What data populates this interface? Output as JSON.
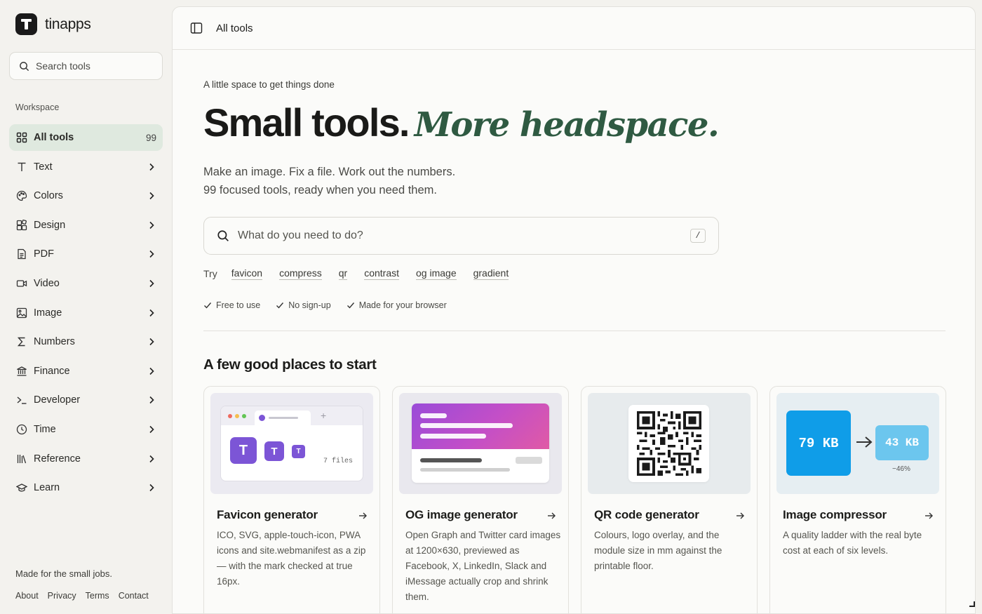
{
  "app": {
    "name": "tinapps"
  },
  "sidebar": {
    "search_placeholder": "Search tools",
    "section_label": "Workspace",
    "items": [
      {
        "label": "All tools",
        "count": "99",
        "icon": "grid-icon",
        "active": true
      },
      {
        "label": "Text",
        "icon": "text-icon"
      },
      {
        "label": "Colors",
        "icon": "palette-icon"
      },
      {
        "label": "Design",
        "icon": "design-icon"
      },
      {
        "label": "PDF",
        "icon": "document-icon"
      },
      {
        "label": "Video",
        "icon": "video-icon"
      },
      {
        "label": "Image",
        "icon": "image-icon"
      },
      {
        "label": "Numbers",
        "icon": "sigma-icon"
      },
      {
        "label": "Finance",
        "icon": "bank-icon"
      },
      {
        "label": "Developer",
        "icon": "terminal-icon"
      },
      {
        "label": "Time",
        "icon": "clock-icon"
      },
      {
        "label": "Reference",
        "icon": "library-icon"
      },
      {
        "label": "Learn",
        "icon": "graduation-cap-icon"
      }
    ],
    "footer_text": "Made for the small jobs.",
    "footer_links": [
      "About",
      "Privacy",
      "Terms",
      "Contact"
    ]
  },
  "topbar": {
    "title": "All tools"
  },
  "hero": {
    "eyebrow": "A little space to get things done",
    "title_plain": "Small tools.",
    "title_italic": "More headspace.",
    "lede_line1": "Make an image. Fix a file. Work out the numbers.",
    "lede_line2": "99 focused tools, ready when you need them."
  },
  "search": {
    "placeholder": "What do you need to do?",
    "shortcut": "/"
  },
  "try": {
    "label": "Try",
    "chips": [
      "favicon",
      "compress",
      "qr",
      "contrast",
      "og image",
      "gradient"
    ]
  },
  "perks": [
    "Free to use",
    "No sign-up",
    "Made for your browser"
  ],
  "section_title": "A few good places to start",
  "cards": [
    {
      "title": "Favicon generator",
      "desc": "ICO, SVG, apple-touch-icon, PWA icons and site.webmanifest as a zip — with the mark checked at true 16px.",
      "media": {
        "files_label": "7 files",
        "glyph": "T"
      }
    },
    {
      "title": "OG image generator",
      "desc": "Open Graph and Twitter card images at 1200×630, previewed as Facebook, X, LinkedIn, Slack and iMessage actually crop and shrink them."
    },
    {
      "title": "QR code generator",
      "desc": "Colours, logo overlay, and the module size in mm against the printable floor."
    },
    {
      "title": "Image compressor",
      "desc": "A quality ladder with the real byte cost at each of six levels.",
      "media": {
        "before": "79 KB",
        "after": "43 KB",
        "delta": "−46%"
      }
    }
  ],
  "colors": {
    "accent_green": "#2f5a42",
    "active_nav_bg": "#dfe9df",
    "favicon_purple": "#7c55d6",
    "compress_blue": "#0f9de8"
  }
}
